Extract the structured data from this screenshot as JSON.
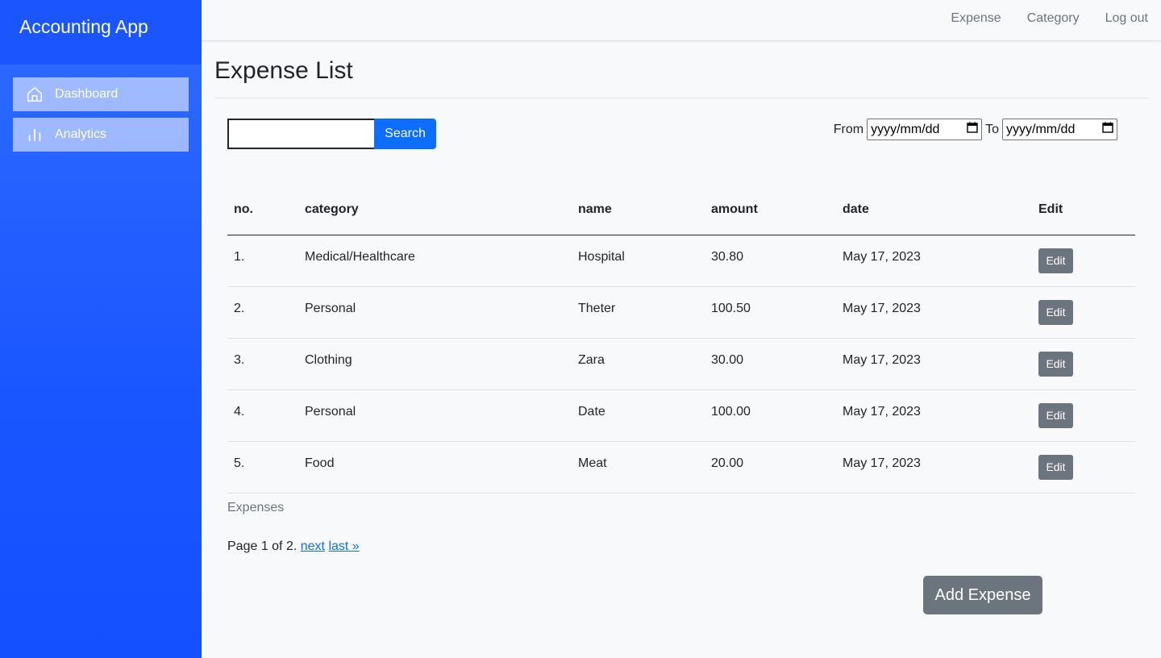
{
  "brand": "Accounting App",
  "sidebar": {
    "items": [
      {
        "label": "Dashboard",
        "icon": "home-icon"
      },
      {
        "label": "Analytics",
        "icon": "bar-chart-icon"
      }
    ]
  },
  "topnav": {
    "expense": "Expense",
    "category": "Category",
    "logout": "Log out"
  },
  "page_title": "Expense List",
  "search": {
    "value": "",
    "button": "Search"
  },
  "date_filter": {
    "from_label": "From",
    "to_label": "To",
    "from_placeholder": "yyyy/mm/dd",
    "to_placeholder": "yyyy/mm/dd"
  },
  "table": {
    "columns": [
      "no.",
      "category",
      "name",
      "amount",
      "date",
      "Edit"
    ],
    "rows": [
      {
        "no": "1.",
        "category": "Medical/Healthcare",
        "name": "Hospital",
        "amount": "30.80",
        "date": "May 17, 2023",
        "edit": "Edit"
      },
      {
        "no": "2.",
        "category": "Personal",
        "name": "Theter",
        "amount": "100.50",
        "date": "May 17, 2023",
        "edit": "Edit"
      },
      {
        "no": "3.",
        "category": "Clothing",
        "name": "Zara",
        "amount": "30.00",
        "date": "May 17, 2023",
        "edit": "Edit"
      },
      {
        "no": "4.",
        "category": "Personal",
        "name": "Date",
        "amount": "100.00",
        "date": "May 17, 2023",
        "edit": "Edit"
      },
      {
        "no": "5.",
        "category": "Food",
        "name": "Meat",
        "amount": "20.00",
        "date": "May 17, 2023",
        "edit": "Edit"
      }
    ],
    "caption": "Expenses"
  },
  "pagination": {
    "text": "Page 1 of 2.",
    "next": "next",
    "last": "last »"
  },
  "add_button": "Add Expense"
}
